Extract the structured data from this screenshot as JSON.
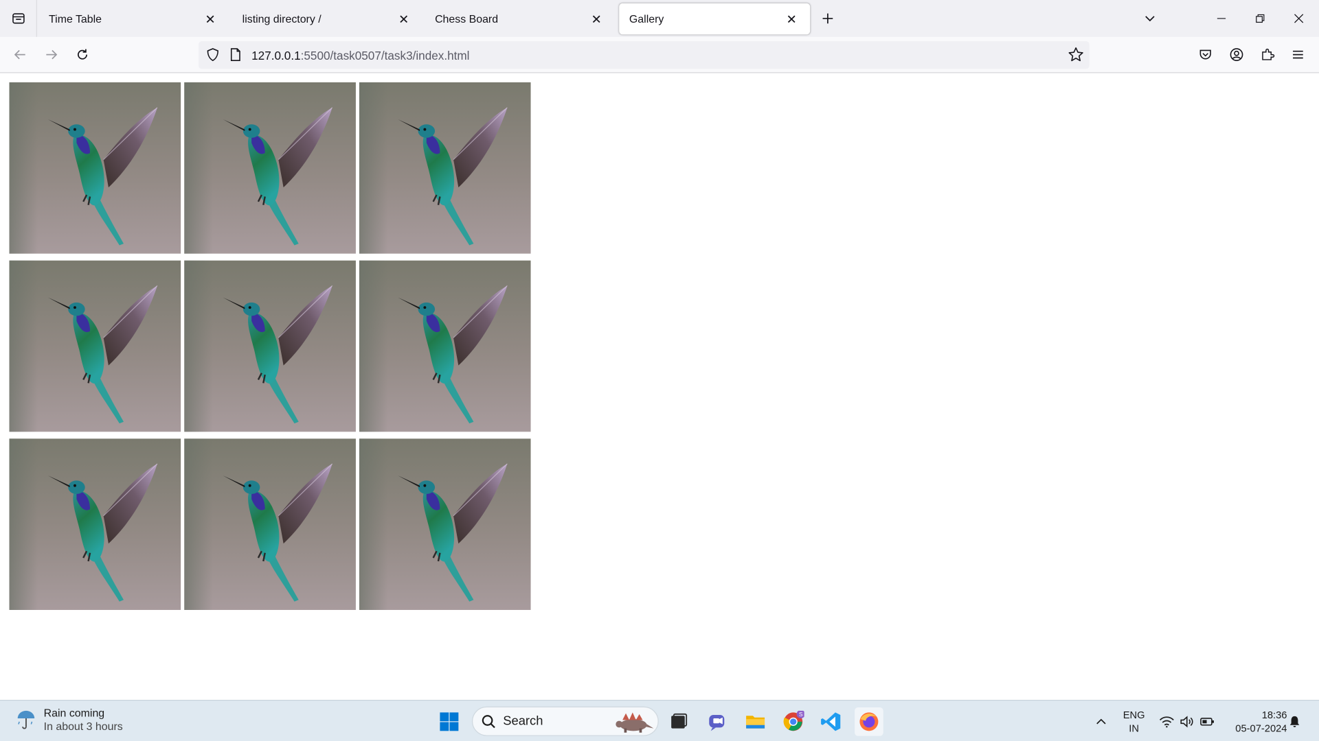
{
  "browser": {
    "tabs": [
      {
        "title": "Time Table",
        "active": false
      },
      {
        "title": "listing directory /",
        "active": false
      },
      {
        "title": "Chess Board",
        "active": false
      },
      {
        "title": "Gallery",
        "active": true
      }
    ],
    "url_host": "127.0.0.1",
    "url_path": ":5500/task0507/task3/index.html"
  },
  "gallery": {
    "image_subject": "hummingbird",
    "rows": 3,
    "columns": 3
  },
  "taskbar": {
    "weather_title": "Rain coming",
    "weather_subtitle": "In about 3 hours",
    "search_label": "Search",
    "lang_top": "ENG",
    "lang_bottom": "IN",
    "time": "18:36",
    "date": "05-07-2024"
  },
  "colors": {
    "tabstrip_bg": "#f0f0f4",
    "taskbar_bg": "#dfe9f1",
    "accent_blue": "#0078d4"
  }
}
